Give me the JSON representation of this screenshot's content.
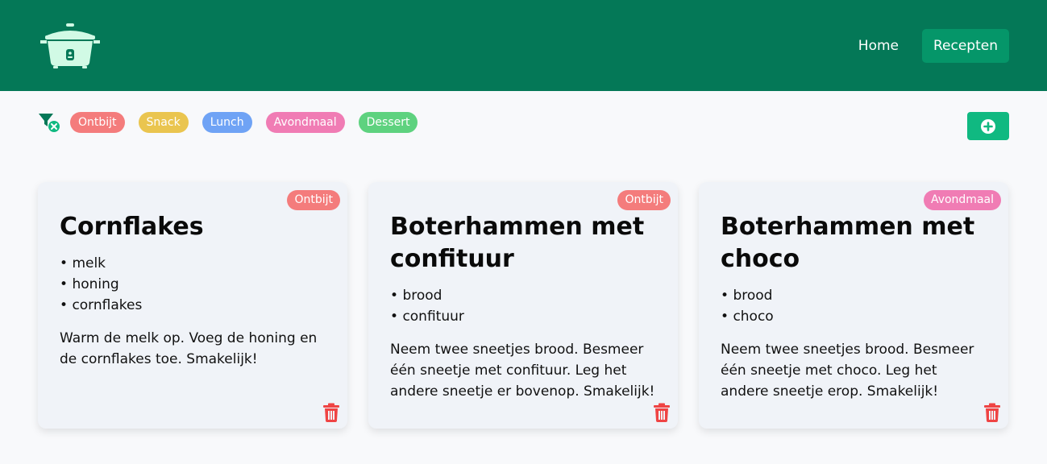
{
  "header": {
    "logo_icon": "rice-cooker-icon",
    "nav": [
      {
        "label": "Home",
        "active": false
      },
      {
        "label": "Recepten",
        "active": true
      }
    ]
  },
  "filters": {
    "clear_icon": "filter-clear-icon",
    "categories": [
      {
        "label": "Ontbijt",
        "color": "#f47c7c"
      },
      {
        "label": "Snack",
        "color": "#eac54f"
      },
      {
        "label": "Lunch",
        "color": "#6fa3f5"
      },
      {
        "label": "Avondmaal",
        "color": "#f07cb4"
      },
      {
        "label": "Dessert",
        "color": "#5ed27f"
      }
    ],
    "add_icon": "plus-circle-icon"
  },
  "recipes": [
    {
      "category": "Ontbijt",
      "category_color": "#f47c7c",
      "title": "Cornflakes",
      "ingredients": [
        "melk",
        "honing",
        "cornflakes"
      ],
      "instructions": "Warm de melk op. Voeg de honing en de cornflakes toe. Smakelijk!"
    },
    {
      "category": "Ontbijt",
      "category_color": "#f47c7c",
      "title": "Boterhammen met confituur",
      "ingredients": [
        "brood",
        "confituur"
      ],
      "instructions": "Neem twee sneetjes brood. Besmeer één sneetje met confituur. Leg het andere sneetje er bovenop. Smakelijk!"
    },
    {
      "category": "Avondmaal",
      "category_color": "#f07cb4",
      "title": "Boterhammen met choco",
      "ingredients": [
        "brood",
        "choco"
      ],
      "instructions": "Neem twee sneetjes brood. Besmeer één sneetje met choco. Leg het andere sneetje erop. Smakelijk!"
    }
  ],
  "colors": {
    "header_bg": "#047857",
    "nav_active": "#059669",
    "add_button": "#10b981",
    "trash": "#ef4444"
  }
}
